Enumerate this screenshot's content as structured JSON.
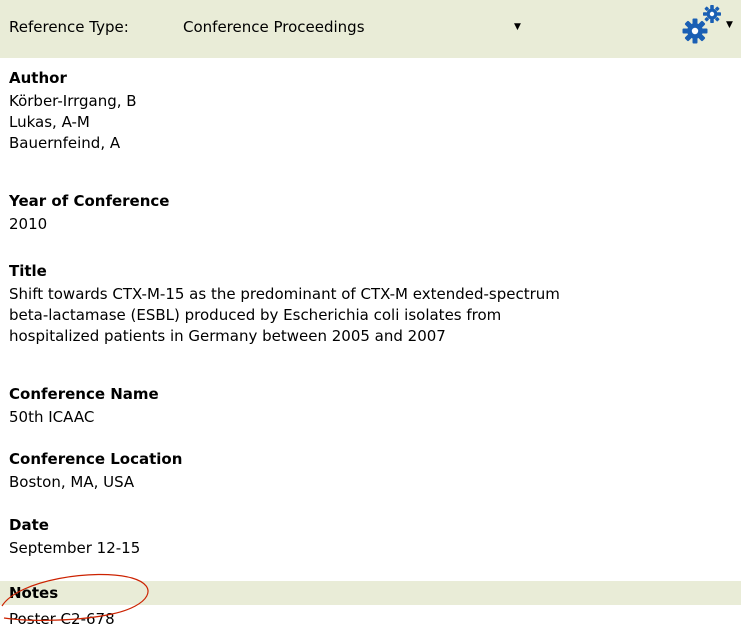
{
  "toolbar": {
    "ref_type_label": "Reference Type:",
    "ref_type_value": "Conference Proceedings",
    "background_color": "#e9ecd7",
    "gear_icon": "gear-icon",
    "gear_color": "#1a5fb4"
  },
  "fields": [
    {
      "label": "Author",
      "lines": [
        "Körber-Irrgang, B",
        "Lukas, A-M",
        "Bauernfeind, A"
      ]
    },
    {
      "label": "Year of Conference",
      "lines": [
        "2010"
      ]
    },
    {
      "label": "Title",
      "lines": [
        "Shift towards CTX-M-15 as the predominant of CTX-M extended-spectrum",
        "beta-lactamase (ESBL) produced by Escherichia coli isolates from",
        "hospitalized patients in Germany between 2005 and 2007"
      ]
    },
    {
      "label": "Conference Name",
      "lines": [
        "50th ICAAC"
      ]
    },
    {
      "label": "Conference Location",
      "lines": [
        "Boston, MA, USA"
      ]
    },
    {
      "label": "Date",
      "lines": [
        "September 12-15"
      ]
    }
  ],
  "notes": {
    "label": "Notes",
    "value": "Poster C2-678",
    "highlight_color": "#e9ecd7",
    "annotation_color": "#cc2200"
  }
}
